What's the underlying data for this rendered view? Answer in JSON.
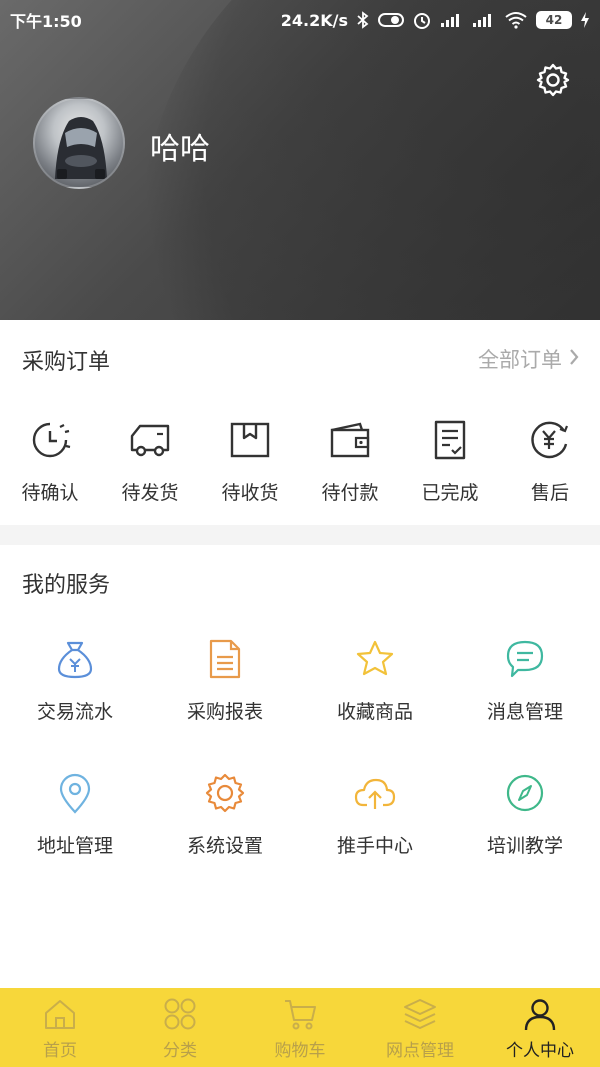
{
  "status_bar": {
    "time": "下午1:50",
    "network_speed": "24.2K/s",
    "battery": "42"
  },
  "profile": {
    "username": "哈哈"
  },
  "orders": {
    "title": "采购订单",
    "all_label": "全部订单",
    "items": [
      {
        "label": "待确认",
        "icon": "clock-icon"
      },
      {
        "label": "待发货",
        "icon": "truck-icon"
      },
      {
        "label": "待收货",
        "icon": "box-icon"
      },
      {
        "label": "待付款",
        "icon": "wallet-icon"
      },
      {
        "label": "已完成",
        "icon": "document-check-icon"
      },
      {
        "label": "售后",
        "icon": "yuan-refund-icon"
      }
    ]
  },
  "services": {
    "title": "我的服务",
    "items": [
      {
        "label": "交易流水",
        "icon": "money-bag-icon",
        "color": "#5b8fd9"
      },
      {
        "label": "采购报表",
        "icon": "report-icon",
        "color": "#e89a4a"
      },
      {
        "label": "收藏商品",
        "icon": "star-icon",
        "color": "#f2c23a"
      },
      {
        "label": "消息管理",
        "icon": "chat-icon",
        "color": "#3fb8a0"
      },
      {
        "label": "地址管理",
        "icon": "location-icon",
        "color": "#6fb3e0"
      },
      {
        "label": "系统设置",
        "icon": "settings-icon",
        "color": "#e88a3a"
      },
      {
        "label": "推手中心",
        "icon": "cloud-upload-icon",
        "color": "#f2b53a"
      },
      {
        "label": "培训教学",
        "icon": "compass-icon",
        "color": "#3fb88a"
      }
    ]
  },
  "tabbar": {
    "items": [
      {
        "label": "首页",
        "icon": "home-icon"
      },
      {
        "label": "分类",
        "icon": "grid-icon"
      },
      {
        "label": "购物车",
        "icon": "cart-icon"
      },
      {
        "label": "网点管理",
        "icon": "layers-icon"
      },
      {
        "label": "个人中心",
        "icon": "person-icon"
      }
    ],
    "active_index": 4
  }
}
